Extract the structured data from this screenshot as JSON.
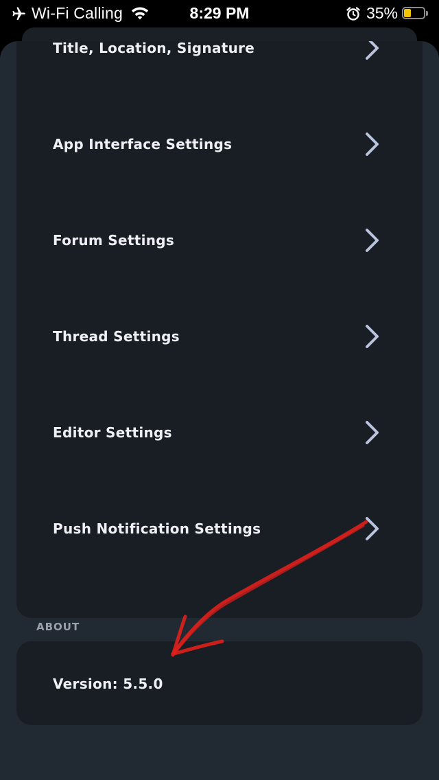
{
  "status_bar": {
    "carrier": "Wi-Fi Calling",
    "time": "8:29 PM",
    "battery_percent": "35%",
    "battery_level": 0.35,
    "battery_color": "#f5c400",
    "icons": [
      "airplane-icon",
      "wifi-icon",
      "alarm-icon",
      "battery-icon"
    ]
  },
  "settings": {
    "items": [
      {
        "label": "Title, Location, Signature"
      },
      {
        "label": "App Interface Settings"
      },
      {
        "label": "Forum Settings"
      },
      {
        "label": "Thread Settings"
      },
      {
        "label": "Editor Settings"
      },
      {
        "label": "Push Notification Settings"
      }
    ]
  },
  "about": {
    "header": "ABOUT",
    "version": "Version: 5.5.0"
  },
  "colors": {
    "background": "#212933",
    "card": "#191d24",
    "chevron": "#b9c3dc",
    "annotation": "#e0201c"
  }
}
